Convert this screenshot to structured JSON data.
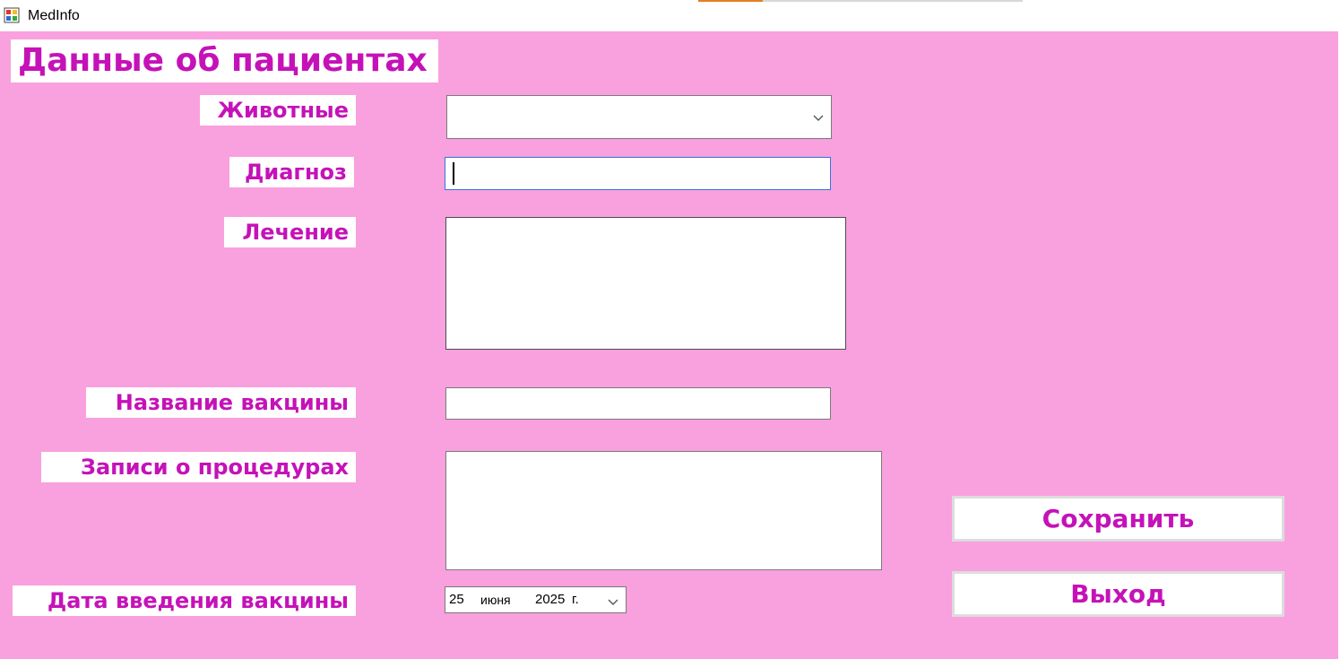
{
  "window": {
    "title": "MedInfo",
    "icon": "app-icon"
  },
  "form": {
    "heading": "Данные об пациентах",
    "fields": {
      "animals": {
        "label": "Животные",
        "value": ""
      },
      "diagnosis": {
        "label": "Диагноз",
        "value": ""
      },
      "treatment": {
        "label": "Лечение",
        "value": ""
      },
      "vaccine_name": {
        "label": "Название вакцины",
        "value": ""
      },
      "procedure_records": {
        "label": "Записи о процедурах",
        "value": ""
      },
      "vaccination_date": {
        "label": "Дата введения вакцины",
        "day": "25",
        "month": "июня",
        "year": "2025",
        "year_suffix": "г."
      }
    },
    "buttons": {
      "save": "Сохранить",
      "exit": "Выход"
    }
  },
  "colors": {
    "background": "#f9a0de",
    "label_text": "#c512b8",
    "label_background": "#ffffff",
    "focus_border": "#3277d8"
  }
}
